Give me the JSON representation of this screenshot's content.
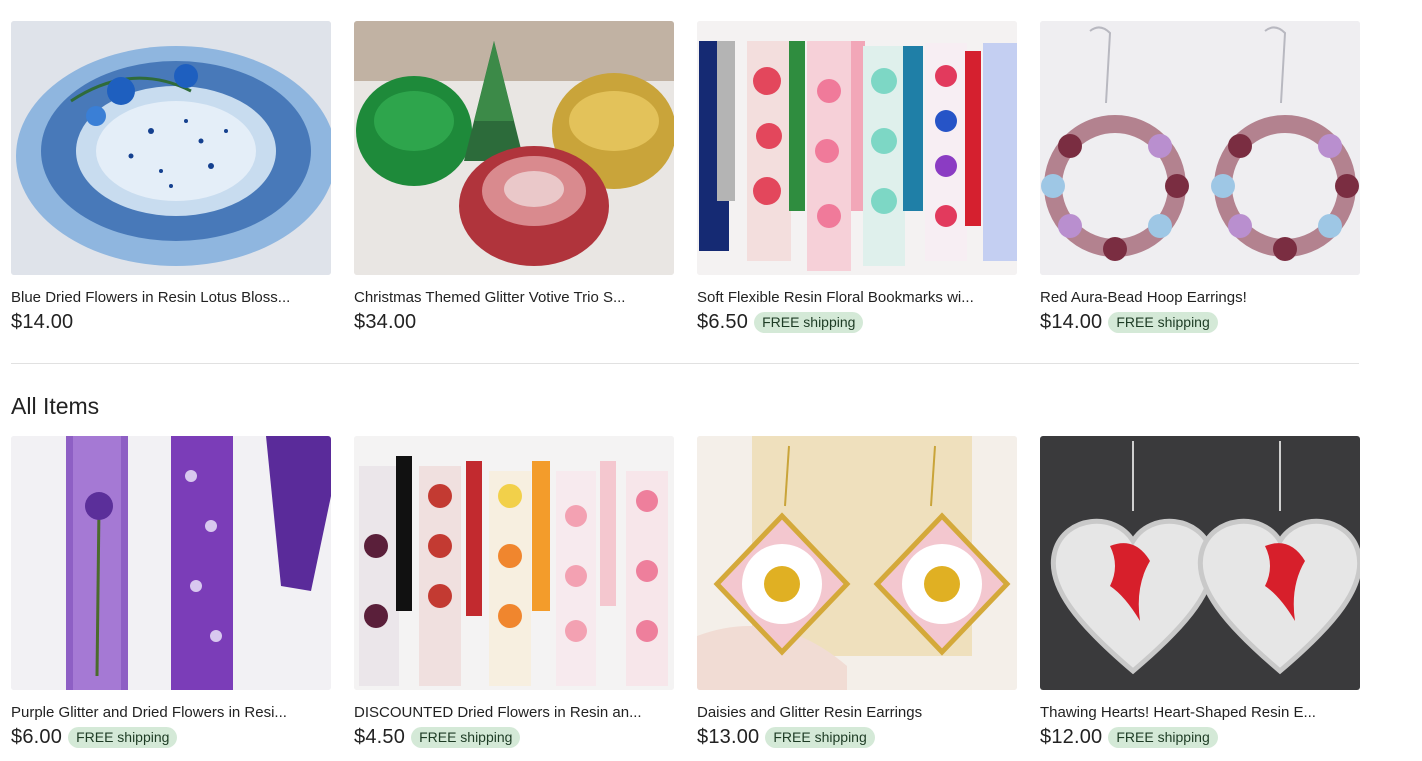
{
  "featured": [
    {
      "title": "Blue Dried Flowers in Resin Lotus Blossom Trinket Dish",
      "display_title": "Blue Dried Flowers in Resin Lotus Bloss...",
      "price": "$14.00",
      "shipping": ""
    },
    {
      "title": "Christmas Themed Glitter Votive Trio Set",
      "display_title": "Christmas Themed Glitter Votive Trio S...",
      "price": "$34.00",
      "shipping": ""
    },
    {
      "title": "Soft Flexible Resin Floral Bookmarks with Tassels",
      "display_title": "Soft Flexible Resin Floral Bookmarks wi...",
      "price": "$6.50",
      "shipping": "FREE shipping"
    },
    {
      "title": "Red Aura-Bead Hoop Earrings!",
      "display_title": "Red Aura-Bead Hoop Earrings!",
      "price": "$14.00",
      "shipping": "FREE shipping"
    }
  ],
  "section": {
    "title": "All Items"
  },
  "all_items": [
    {
      "title": "Purple Glitter and Dried Flowers in Resin Bookmark",
      "display_title": "Purple Glitter and Dried Flowers in Resi...",
      "price": "$6.00",
      "shipping": "FREE shipping"
    },
    {
      "title": "DISCOUNTED Dried Flowers in Resin and Tassel Bookmarks",
      "display_title": "DISCOUNTED Dried Flowers in Resin an...",
      "price": "$4.50",
      "shipping": "FREE shipping"
    },
    {
      "title": "Daisies and Glitter Resin Earrings",
      "display_title": "Daisies and Glitter Resin Earrings",
      "price": "$13.00",
      "shipping": "FREE shipping"
    },
    {
      "title": "Thawing Hearts! Heart-Shaped Resin Earrings",
      "display_title": "Thawing Hearts! Heart-Shaped Resin E...",
      "price": "$12.00",
      "shipping": "FREE shipping"
    }
  ],
  "colors": {
    "badge_bg": "#d4e9d7",
    "badge_text": "#1d3b24",
    "divider": "#e1e1e1"
  }
}
